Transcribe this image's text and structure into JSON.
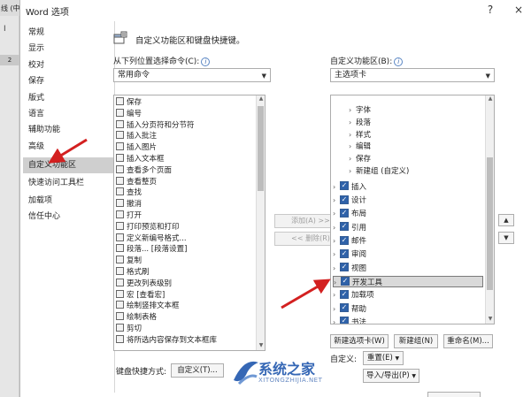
{
  "background": {
    "tab_fragment": "线 (中",
    "marker": "I",
    "ruler_number": "2"
  },
  "dialog": {
    "title": "Word 选项",
    "help": "?",
    "close": "×"
  },
  "nav": {
    "items": [
      {
        "label": "常规"
      },
      {
        "label": "显示"
      },
      {
        "label": "校对"
      },
      {
        "label": "保存"
      },
      {
        "label": "版式"
      },
      {
        "label": "语言"
      },
      {
        "label": "辅助功能"
      },
      {
        "label": "高级"
      },
      {
        "label": "自定义功能区"
      },
      {
        "label": "快速访问工具栏"
      },
      {
        "label": "加载项"
      },
      {
        "label": "信任中心"
      }
    ],
    "selected_index": 8
  },
  "header": {
    "text": "自定义功能区和键盘快捷键。"
  },
  "left_pane": {
    "label": "从下列位置选择命令(C):",
    "info": "i",
    "combo_value": "常用命令",
    "commands": [
      {
        "label": "保存"
      },
      {
        "label": "编号"
      },
      {
        "label": "插入分页符和分节符"
      },
      {
        "label": "插入批注"
      },
      {
        "label": "插入图片"
      },
      {
        "label": "插入文本框"
      },
      {
        "label": "查看多个页面"
      },
      {
        "label": "查看整页"
      },
      {
        "label": "查找"
      },
      {
        "label": "撤消"
      },
      {
        "label": "打开"
      },
      {
        "label": "打印预览和打印"
      },
      {
        "label": "定义新编号格式..."
      },
      {
        "label": "段落... [段落设置]"
      },
      {
        "label": "复制"
      },
      {
        "label": "格式刷"
      },
      {
        "label": "更改列表级别"
      },
      {
        "label": "宏 [查看宏]"
      },
      {
        "label": "绘制竖排文本框"
      },
      {
        "label": "绘制表格"
      },
      {
        "label": "剪切"
      },
      {
        "label": "将所选内容保存到文本框库"
      }
    ],
    "submenu_glyph": "|>"
  },
  "middle": {
    "add_label": "添加(A) >>",
    "remove_label": "<< 删除(R)"
  },
  "right_pane": {
    "label": "自定义功能区(B):",
    "info": "i",
    "combo_value": "主选项卡",
    "groups": [
      {
        "label": "字体"
      },
      {
        "label": "段落"
      },
      {
        "label": "样式"
      },
      {
        "label": "编辑"
      },
      {
        "label": "保存"
      },
      {
        "label": "新建组 (自定义)"
      }
    ],
    "tabs": [
      {
        "label": "插入"
      },
      {
        "label": "设计"
      },
      {
        "label": "布局"
      },
      {
        "label": "引用"
      },
      {
        "label": "邮件"
      },
      {
        "label": "审阅"
      },
      {
        "label": "视图"
      },
      {
        "label": "开发工具"
      },
      {
        "label": "加载项"
      },
      {
        "label": "帮助"
      },
      {
        "label": "书法"
      }
    ],
    "selected_tab": "开发工具",
    "new_tab_button": "新建选项卡(W)",
    "new_group_button": "新建组(N)",
    "rename_button": "重命名(M)...",
    "customize_label": "自定义:",
    "reset_button": "重置(E)",
    "import_export_button": "导入/导出(P)",
    "up": "▲",
    "down": "▼"
  },
  "keyboard": {
    "label": "键盘快捷方式:",
    "button": "自定义(T)..."
  },
  "watermark": {
    "text": "系统之家",
    "sub": "XITONGZHIJIA.NET"
  },
  "colors": {
    "accent": "#2f62a9",
    "selected_nav": "#cfcfcf",
    "annotation_arrow": "#d32020"
  }
}
